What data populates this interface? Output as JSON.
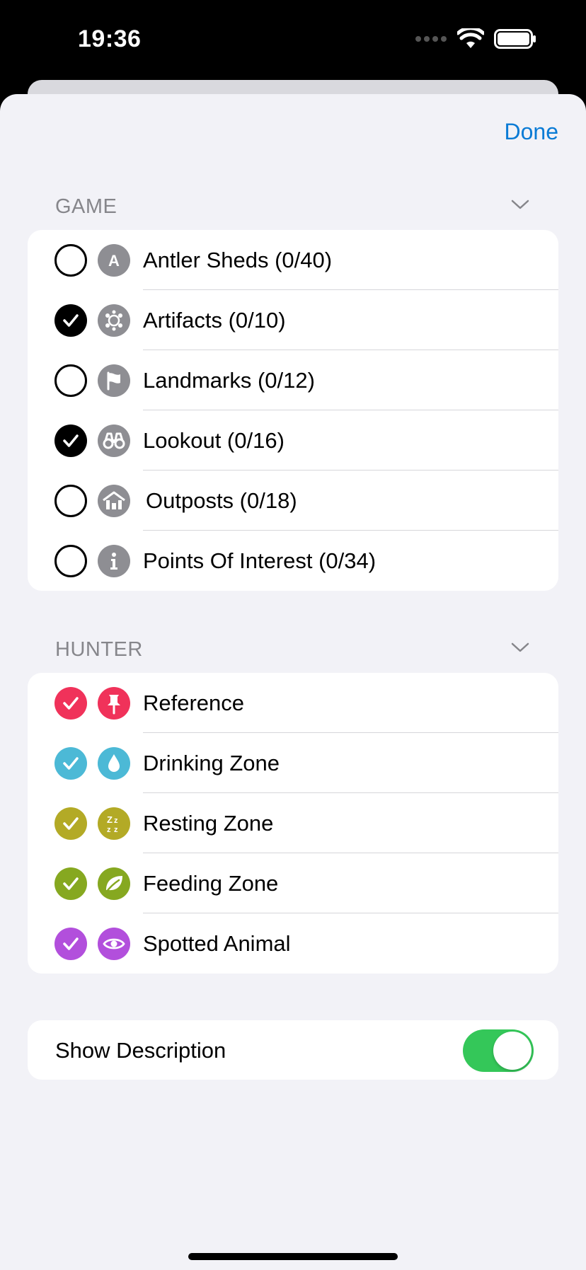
{
  "status_bar": {
    "time": "19:36"
  },
  "sheet": {
    "done_label": "Done"
  },
  "game": {
    "title": "GAME",
    "items": [
      {
        "label": "Antler Sheds  (0/40)",
        "checked": false,
        "icon": "letter-a-icon",
        "icon_color": "#8e8e93"
      },
      {
        "label": "Artifacts  (0/10)",
        "checked": true,
        "icon": "artifacts-icon",
        "icon_color": "#8e8e93"
      },
      {
        "label": "Landmarks  (0/12)",
        "checked": false,
        "icon": "flag-icon",
        "icon_color": "#8e8e93"
      },
      {
        "label": "Lookout  (0/16)",
        "checked": true,
        "icon": "binoculars-icon",
        "icon_color": "#8e8e93"
      },
      {
        "label": "Outposts  (0/18)",
        "checked": false,
        "icon": "outpost-house-icon",
        "icon_color": "#8e8e93"
      },
      {
        "label": "Points Of Interest  (0/34)",
        "checked": false,
        "icon": "info-icon",
        "icon_color": "#8e8e93"
      }
    ]
  },
  "hunter": {
    "title": "HUNTER",
    "items": [
      {
        "label": "Reference",
        "checked": true,
        "icon": "pin-icon",
        "color": "#f0325a"
      },
      {
        "label": "Drinking Zone",
        "checked": true,
        "icon": "water-drop-icon",
        "color": "#4cb9d6"
      },
      {
        "label": "Resting Zone",
        "checked": true,
        "icon": "sleep-zzz-icon",
        "color": "#b3aa26"
      },
      {
        "label": "Feeding Zone",
        "checked": true,
        "icon": "leaf-icon",
        "color": "#86a820"
      },
      {
        "label": "Spotted Animal",
        "checked": true,
        "icon": "eye-icon",
        "color": "#b24fdc"
      }
    ]
  },
  "settings": {
    "show_description_label": "Show Description",
    "show_description_on": true
  },
  "colors": {
    "accent": "#0a7bd5",
    "toggle_on": "#34c759",
    "section_text": "#86868b"
  }
}
